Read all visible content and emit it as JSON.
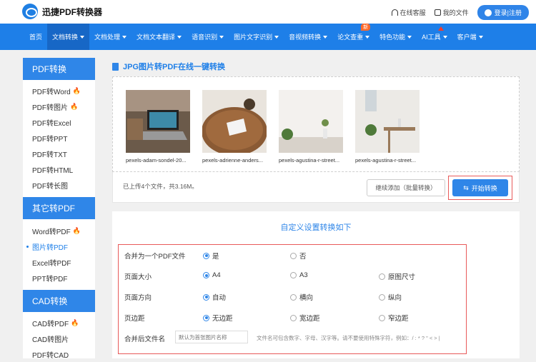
{
  "header": {
    "logo_text": "迅捷PDF转换器",
    "customer_service": "在线客服",
    "my_files": "我的文件",
    "login": "登录|注册"
  },
  "nav": {
    "items": [
      "首页",
      "文档转换",
      "文档处理",
      "文档文本翻译",
      "语音识别",
      "图片文字识别",
      "音视频转换",
      "论文查重",
      "特色功能",
      "AI工具",
      "客户端"
    ],
    "new_badge": "新"
  },
  "sidebar": {
    "sections": [
      {
        "title": "PDF转换",
        "items": [
          "PDF转Word",
          "PDF转图片",
          "PDF转Excel",
          "PDF转PPT",
          "PDF转TXT",
          "PDF转HTML",
          "PDF转长图"
        ]
      },
      {
        "title": "其它转PDF",
        "items": [
          "Word转PDF",
          "图片转PDF",
          "Excel转PDF",
          "PPT转PDF"
        ]
      },
      {
        "title": "CAD转换",
        "items": [
          "CAD转PDF",
          "CAD转图片",
          "PDF转CAD"
        ]
      }
    ]
  },
  "main": {
    "title": "JPG图片转PDF在线一键转换",
    "files": [
      "pexels-adam-sondel-20...",
      "pexels-adrienne-anders...",
      "pexels-agustina-r-street...",
      "pexels-agustina-r-street..."
    ],
    "status": "已上传4个文件，共3.16M。",
    "add_button": "继续添加（批量转换）",
    "start_button": "开始转换",
    "settings_title": "自定义设置转换如下",
    "options": {
      "merge": {
        "label": "合并为一个PDF文件",
        "choices": [
          "是",
          "否"
        ]
      },
      "page_size": {
        "label": "页面大小",
        "choices": [
          "A4",
          "A3",
          "原图尺寸"
        ]
      },
      "orientation": {
        "label": "页面方向",
        "choices": [
          "自动",
          "横向",
          "纵向"
        ]
      },
      "margin": {
        "label": "页边距",
        "choices": [
          "无边距",
          "宽边距",
          "窄边距"
        ]
      },
      "filename": {
        "label": "合并后文件名",
        "placeholder": "默认为首张图片名称",
        "tip": "文件名可包含数字、字母、汉字等。请不要使用特殊字符，例如：/ : * ? \" < > |"
      }
    }
  },
  "colors": {
    "brand": "#1e7fe8",
    "highlight": "#e85a5a",
    "fire": "#ff6a2a"
  }
}
